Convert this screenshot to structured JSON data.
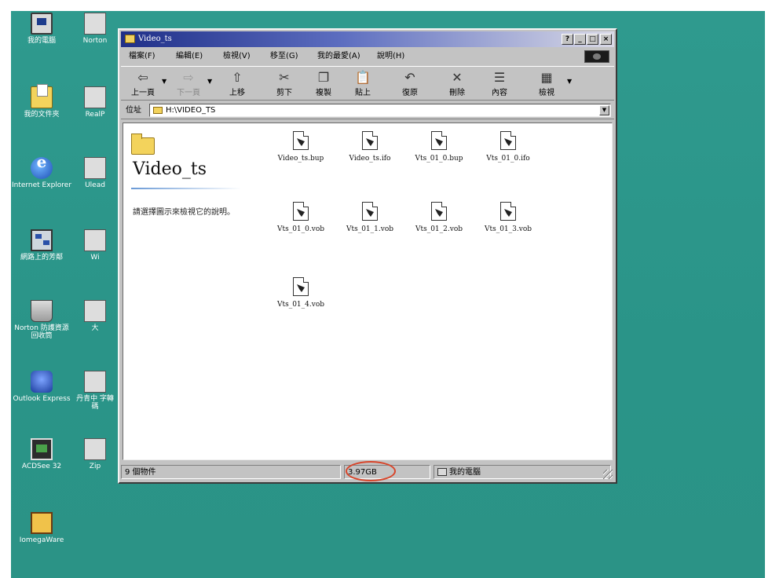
{
  "desktop": {
    "icons": [
      {
        "label": "我的電腦",
        "icon": "my-computer-icon"
      },
      {
        "label": "我的文件夾",
        "icon": "my-documents-icon"
      },
      {
        "label": "Internet Explorer",
        "icon": "internet-explorer-icon"
      },
      {
        "label": "網路上的芳鄰",
        "icon": "network-neighborhood-icon"
      },
      {
        "label": "Norton 防護資源回收筒",
        "icon": "recycle-bin-icon"
      },
      {
        "label": "Outlook Express",
        "icon": "outlook-express-icon"
      },
      {
        "label": "ACDSee 32",
        "icon": "acdsee-icon"
      },
      {
        "label": "IomegaWare",
        "icon": "iomegaware-icon"
      }
    ],
    "partial_icons": [
      {
        "label": "Norton"
      },
      {
        "label": "RealP"
      },
      {
        "label": "Ulead"
      },
      {
        "label": "Wi"
      },
      {
        "label": "大"
      },
      {
        "label": "丹青中 字轉碼"
      },
      {
        "label": "Zip"
      }
    ]
  },
  "window": {
    "title": "Video_ts",
    "title_buttons": {
      "help": "?",
      "minimize": "_",
      "maximize": "□",
      "close": "×"
    },
    "menu": [
      "檔案(F)",
      "編輯(E)",
      "檢視(V)",
      "移至(G)",
      "我的最愛(A)",
      "說明(H)"
    ],
    "toolbar": [
      {
        "label": "上一頁",
        "icon": "back-arrow-icon",
        "glyph": "⇦",
        "disabled": false
      },
      {
        "label": "下一頁",
        "icon": "forward-arrow-icon",
        "glyph": "⇨",
        "disabled": true
      },
      {
        "label": "上移",
        "icon": "up-folder-icon",
        "glyph": "⇧",
        "disabled": false
      },
      {
        "label": "剪下",
        "icon": "cut-icon",
        "glyph": "✂",
        "disabled": false
      },
      {
        "label": "複製",
        "icon": "copy-icon",
        "glyph": "❐",
        "disabled": false
      },
      {
        "label": "貼上",
        "icon": "paste-icon",
        "glyph": "📋",
        "disabled": false
      },
      {
        "label": "復原",
        "icon": "undo-icon",
        "glyph": "↶",
        "disabled": false
      },
      {
        "label": "刪除",
        "icon": "delete-icon",
        "glyph": "✕",
        "disabled": false
      },
      {
        "label": "內容",
        "icon": "properties-icon",
        "glyph": "☰",
        "disabled": false
      },
      {
        "label": "檢視",
        "icon": "views-icon",
        "glyph": "▦",
        "disabled": false
      }
    ],
    "address": {
      "label": "位址",
      "value": "H:\\VIDEO_TS"
    },
    "panel": {
      "title": "Video_ts",
      "description": "請選擇圖示來檢視它的說明。"
    },
    "files": [
      {
        "name": "Video_ts.bup"
      },
      {
        "name": "Video_ts.ifo"
      },
      {
        "name": "Vts_01_0.bup"
      },
      {
        "name": "Vts_01_0.ifo"
      },
      {
        "name": "Vts_01_0.vob"
      },
      {
        "name": "Vts_01_1.vob"
      },
      {
        "name": "Vts_01_2.vob"
      },
      {
        "name": "Vts_01_3.vob"
      },
      {
        "name": "Vts_01_4.vob"
      }
    ],
    "status": {
      "objects": "9 個物件",
      "size": "3.97GB",
      "location": "我的電腦"
    }
  },
  "colors": {
    "desktop": "#2f9a8e",
    "title_start": "#1f2f88",
    "highlight_circle": "#d8452a"
  }
}
